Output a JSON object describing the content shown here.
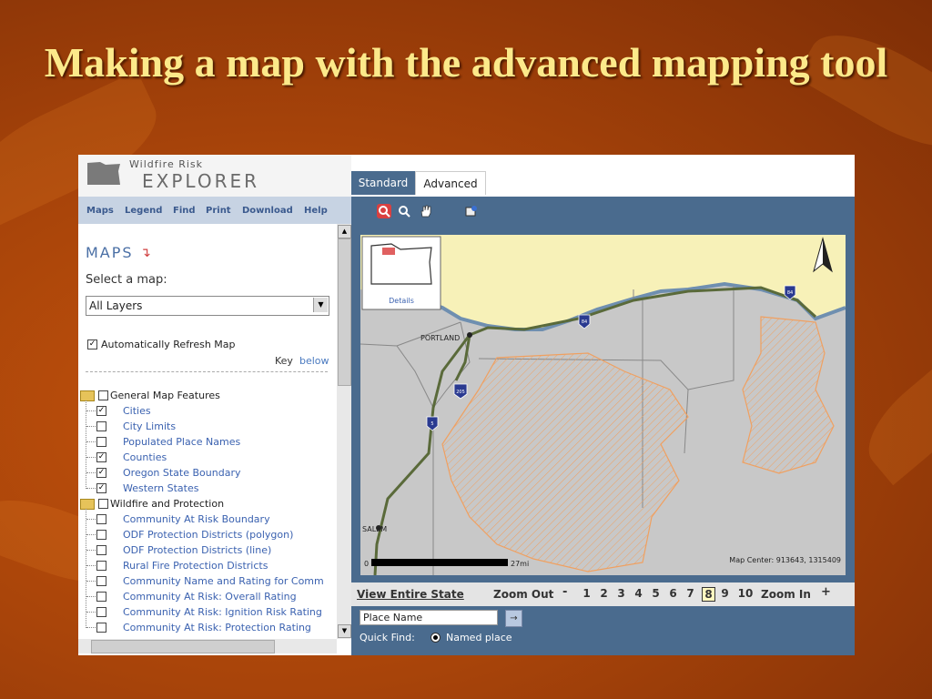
{
  "slide": {
    "title": "Making a map with the advanced mapping tool"
  },
  "app": {
    "logo_small": "Wildfire Risk",
    "logo_big": "EXPLORER",
    "menu": [
      "Maps",
      "Legend",
      "Find",
      "Print",
      "Download",
      "Help"
    ]
  },
  "left_panel": {
    "heading": "MAPS",
    "select_label": "Select a map:",
    "select_value": "All Layers",
    "auto_refresh": "Automatically Refresh Map",
    "key_label": "Key",
    "key_link": "below",
    "groups": [
      {
        "label": "General Map Features",
        "checked": false,
        "layers": [
          {
            "label": "Cities",
            "checked": true
          },
          {
            "label": "City Limits",
            "checked": false
          },
          {
            "label": "Populated Place Names",
            "checked": false
          },
          {
            "label": "Counties",
            "checked": true
          },
          {
            "label": "Oregon State Boundary",
            "checked": true
          },
          {
            "label": "Western States",
            "checked": true
          }
        ]
      },
      {
        "label": "Wildfire and Protection",
        "checked": false,
        "layers": [
          {
            "label": "Community At Risk Boundary",
            "checked": false
          },
          {
            "label": "ODF Protection Districts (polygon)",
            "checked": false
          },
          {
            "label": "ODF Protection Districts (line)",
            "checked": false
          },
          {
            "label": "Rural Fire Protection Districts",
            "checked": false
          },
          {
            "label": "Community Name and Rating for Comm",
            "checked": false
          },
          {
            "label": "Community At Risk: Overall Rating",
            "checked": false
          },
          {
            "label": "Community At Risk: Ignition Risk Rating",
            "checked": false
          },
          {
            "label": "Community At Risk: Protection Rating",
            "checked": false
          }
        ]
      }
    ]
  },
  "tabs": {
    "standard": "Standard",
    "advanced": "Advanced"
  },
  "toolbar": {
    "icons": [
      "zoom-in-icon",
      "zoom-out-icon",
      "pan-hand-icon",
      "identify-icon"
    ]
  },
  "map": {
    "overview_label": "Details",
    "city_labels": [
      "PORTLAND",
      "SALEM"
    ],
    "highway_shields": [
      "84",
      "84",
      "205",
      "5"
    ],
    "scale_start": "0",
    "scale_end": "27mi",
    "center_text": "Map Center: 913643, 1315409",
    "compass": "N"
  },
  "bottom_bar": {
    "view_entire_state": "View Entire State",
    "zoom_out": "Zoom Out",
    "zoom_in": "Zoom In",
    "minus": "-",
    "plus": "+",
    "levels": [
      "1",
      "2",
      "3",
      "4",
      "5",
      "6",
      "7",
      "8",
      "9",
      "10"
    ],
    "selected_level": "8"
  },
  "find_bar": {
    "place_value": "Place Name",
    "go_label": "→",
    "quick_find": "Quick Find:",
    "named_place": "Named place"
  }
}
